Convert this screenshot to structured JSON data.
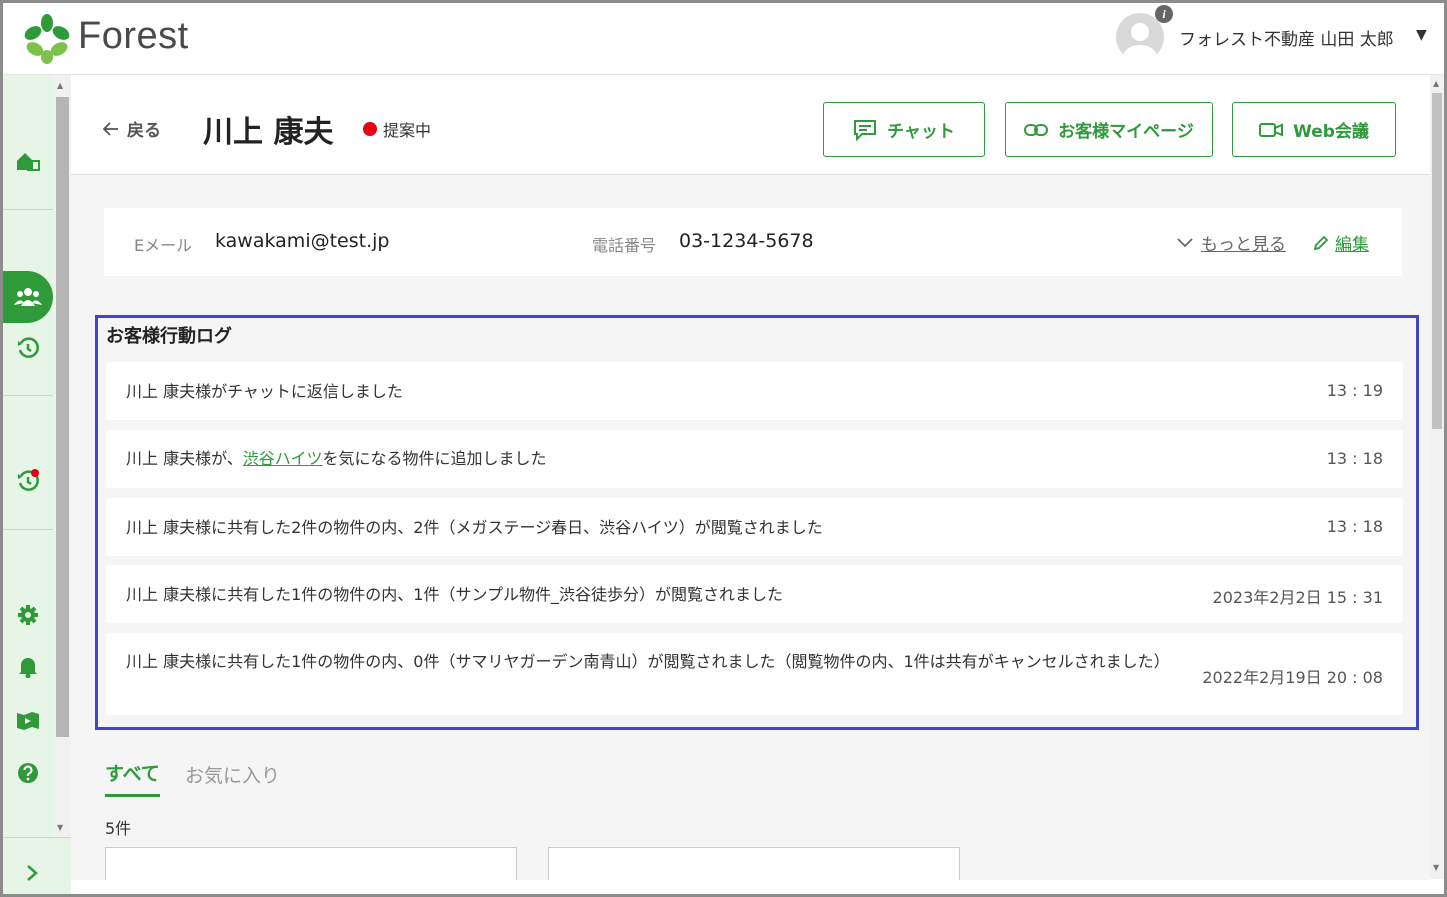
{
  "app": {
    "logo_text": "Forest"
  },
  "user": {
    "name": "フォレスト不動産 山田 太郎",
    "caret": "▼",
    "info": "i"
  },
  "header": {
    "back_label": "戻る",
    "customer_name": "川上 康夫",
    "status": "提案中",
    "status_color": "#e60012",
    "buttons": {
      "chat": "チャット",
      "mypage": "お客様マイページ",
      "web": "Web会議"
    }
  },
  "contact": {
    "email_label": "Eメール",
    "email": "kawakami@test.jp",
    "phone_label": "電話番号",
    "phone": "03-1234-5678",
    "more": "もっと見る",
    "edit": "編集"
  },
  "log": {
    "title": "お客様行動ログ",
    "items": [
      {
        "text": "川上 康夫様がチャットに返信しました",
        "time": "13 : 19"
      },
      {
        "text_pre": "川上 康夫様が、",
        "link": "渋谷ハイツ",
        "text_post": "を気になる物件に追加しました",
        "time": "13 : 18"
      },
      {
        "text": "川上 康夫様に共有した2件の物件の内、2件（メガステージ春日、渋谷ハイツ）が閲覧されました",
        "time": "13 : 18"
      },
      {
        "text": "川上 康夫様に共有した1件の物件の内、1件（サンプル物件_渋谷徒歩分）が閲覧されました",
        "time": "2023年2月2日 15 : 31"
      },
      {
        "text": "川上 康夫様に共有した1件の物件の内、0件（サマリヤガーデン南青山）が閲覧されました（閲覧物件の内、1件は共有がキャンセルされました）",
        "time": "2022年2月19日 20 : 08"
      }
    ]
  },
  "tabs": {
    "all": "すべて",
    "favorites": "お気に入り"
  },
  "count": "5件",
  "nav_icons": [
    "home-icon",
    "users-icon",
    "history-icon",
    "history-alert-icon",
    "gear-icon",
    "bell-icon",
    "map-icon",
    "help-icon"
  ],
  "colors": {
    "accent": "#2e9a3a",
    "highlight_border": "#3f47c8",
    "nav_bg": "#e6f5e6"
  }
}
